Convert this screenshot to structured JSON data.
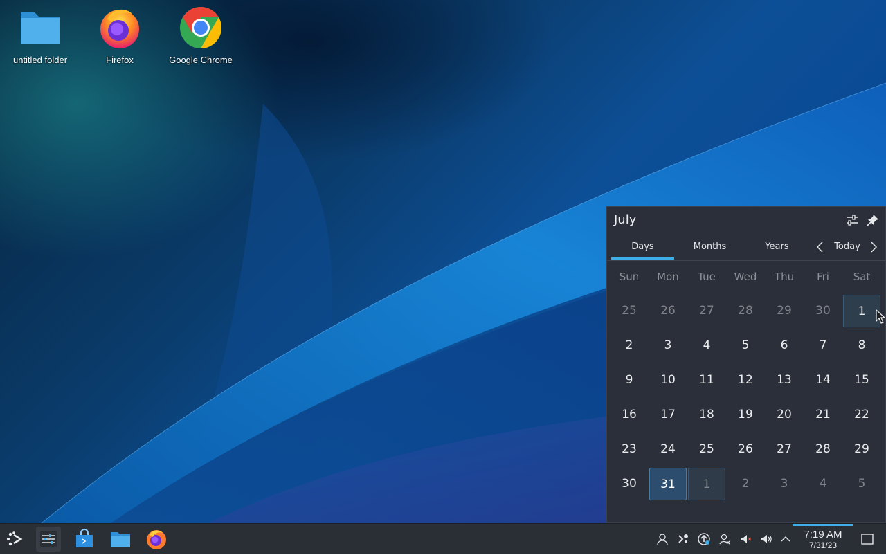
{
  "desktop": {
    "icons": [
      {
        "label": "untitled folder",
        "icon": "folder-icon"
      },
      {
        "label": "Firefox",
        "icon": "firefox-icon"
      },
      {
        "label": "Google Chrome",
        "icon": "chrome-icon"
      }
    ]
  },
  "calendar": {
    "month": "July",
    "tabs": [
      "Days",
      "Months",
      "Years"
    ],
    "active_tab": "Days",
    "today_label": "Today",
    "weekdays": [
      "Sun",
      "Mon",
      "Tue",
      "Wed",
      "Thu",
      "Fri",
      "Sat"
    ],
    "weeks": [
      [
        "25",
        "26",
        "27",
        "28",
        "29",
        "30",
        "1"
      ],
      [
        "2",
        "3",
        "4",
        "5",
        "6",
        "7",
        "8"
      ],
      [
        "9",
        "10",
        "11",
        "12",
        "13",
        "14",
        "15"
      ],
      [
        "16",
        "17",
        "18",
        "19",
        "20",
        "21",
        "22"
      ],
      [
        "23",
        "24",
        "25",
        "26",
        "27",
        "28",
        "29"
      ],
      [
        "30",
        "31",
        "1",
        "2",
        "3",
        "4",
        "5"
      ]
    ],
    "header_icons": [
      "configure-icon",
      "pin-icon"
    ],
    "nav_icons": [
      "chevron-left-icon",
      "chevron-right-icon"
    ]
  },
  "taskbar": {
    "launchers": [
      "application-launcher-icon",
      "system-settings-icon",
      "discover-store-icon",
      "file-manager-icon",
      "firefox-icon"
    ],
    "tray": [
      "user-icon",
      "kde-connect-icon",
      "updates-icon",
      "user-switch-icon",
      "muted-mic-icon",
      "volume-icon",
      "expand-tray-icon"
    ],
    "clock": {
      "time": "7:19 AM",
      "date": "7/31/23"
    }
  },
  "colors": {
    "accent": "#3daee9",
    "panel": "#2a2e35",
    "popup": "#2b2f39"
  }
}
